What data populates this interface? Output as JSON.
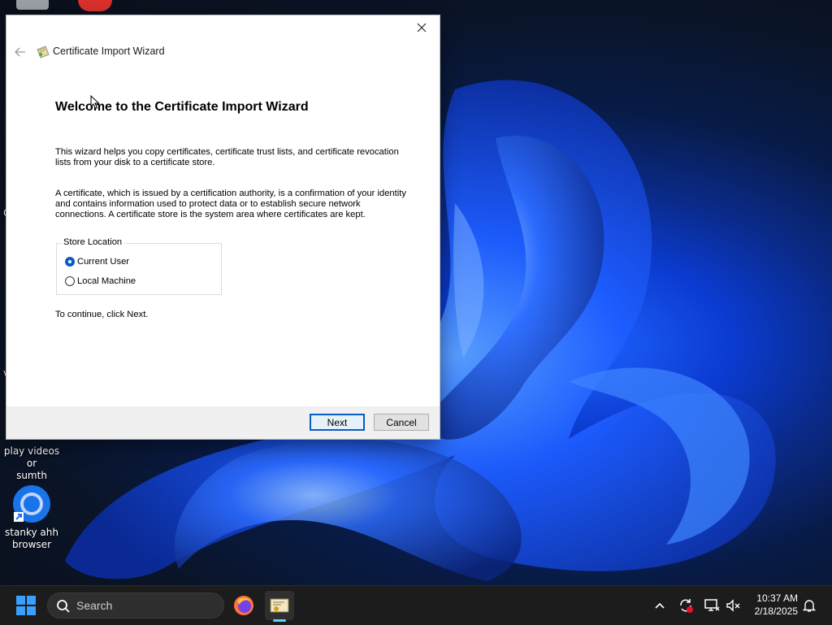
{
  "desktop": {
    "icons": [
      {
        "label_line1": "play videos or",
        "label_line2": "sumth"
      },
      {
        "label_line1": "stanky ahh",
        "label_line2": "browser"
      }
    ],
    "edge_letters": [
      "C",
      "v"
    ]
  },
  "wizard": {
    "title": "Certificate Import Wizard",
    "heading": "Welcome to the Certificate Import Wizard",
    "para1_line1": "This wizard helps you copy certificates, certificate trust lists, and certificate revocation",
    "para1_line2": "lists from your disk to a certificate store.",
    "para2_line1": "A certificate, which is issued by a certification authority, is a confirmation of your identity",
    "para2_line2": "and contains information used to protect data or to establish secure network",
    "para2_line3": "connections. A certificate store is the system area where certificates are kept.",
    "store_location": {
      "label": "Store Location",
      "options": [
        "Current User",
        "Local Machine"
      ],
      "selected": "Current User"
    },
    "continue_text": "To continue, click Next.",
    "next_label": "Next",
    "cancel_label": "Cancel"
  },
  "taskbar": {
    "search_placeholder": "Search",
    "time": "10:37 AM",
    "date": "2/18/2025"
  },
  "colors": {
    "accent": "#0a5cc2",
    "taskbar_bg": "#1c1c1c",
    "window_footer": "#f0f0f0"
  }
}
